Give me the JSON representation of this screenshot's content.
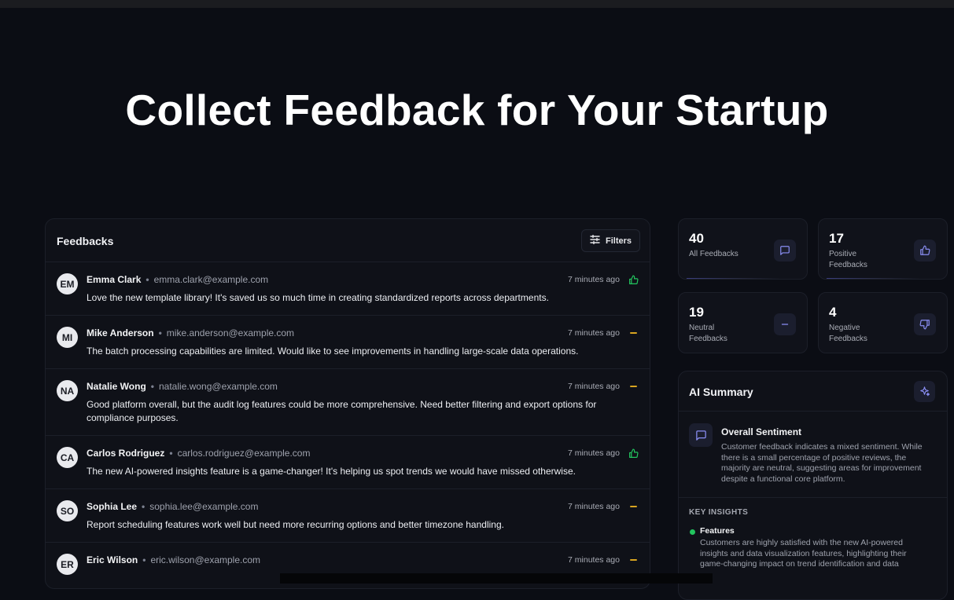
{
  "hero": {
    "title": "Collect Feedback for Your Startup"
  },
  "feedbacks": {
    "title": "Feedbacks",
    "filters_label": "Filters",
    "items": [
      {
        "initials": "EM",
        "name": "Emma Clark",
        "email": "emma.clark@example.com",
        "time": "7 minutes ago",
        "sentiment": "positive",
        "message": "Love the new template library! It's saved us so much time in creating standardized reports across departments."
      },
      {
        "initials": "MI",
        "name": "Mike Anderson",
        "email": "mike.anderson@example.com",
        "time": "7 minutes ago",
        "sentiment": "neutral",
        "message": "The batch processing capabilities are limited. Would like to see improvements in handling large-scale data operations."
      },
      {
        "initials": "NA",
        "name": "Natalie Wong",
        "email": "natalie.wong@example.com",
        "time": "7 minutes ago",
        "sentiment": "neutral",
        "message": "Good platform overall, but the audit log features could be more comprehensive. Need better filtering and export options for compliance purposes."
      },
      {
        "initials": "CA",
        "name": "Carlos Rodriguez",
        "email": "carlos.rodriguez@example.com",
        "time": "7 minutes ago",
        "sentiment": "positive",
        "message": "The new AI-powered insights feature is a game-changer! It's helping us spot trends we would have missed otherwise."
      },
      {
        "initials": "SO",
        "name": "Sophia Lee",
        "email": "sophia.lee@example.com",
        "time": "7 minutes ago",
        "sentiment": "neutral",
        "message": "Report scheduling features work well but need more recurring options and better timezone handling."
      },
      {
        "initials": "ER",
        "name": "Eric Wilson",
        "email": "eric.wilson@example.com",
        "time": "7 minutes ago",
        "sentiment": "neutral",
        "message": ""
      }
    ]
  },
  "stats": {
    "all": {
      "value": "40",
      "label": "All Feedbacks",
      "icon": "message-square-icon"
    },
    "positive": {
      "value": "17",
      "label": "Positive Feedbacks",
      "icon": "thumbs-up-icon"
    },
    "neutral": {
      "value": "19",
      "label": "Neutral Feedbacks",
      "icon": "minus-icon"
    },
    "negative": {
      "value": "4",
      "label": "Negative Feedbacks",
      "icon": "thumbs-down-icon"
    }
  },
  "ai_summary": {
    "title": "AI Summary",
    "sentiment_title": "Overall Sentiment",
    "sentiment_text": "Customer feedback indicates a mixed sentiment. While there is a small percentage of positive reviews, the majority are neutral, suggesting areas for improvement despite a functional core platform.",
    "key_insights_label": "KEY INSIGHTS",
    "insight_title": "Features",
    "insight_text": "Customers are highly satisfied with the new AI-powered insights and data visualization features, highlighting their game-changing impact on trend identification and data"
  },
  "colors": {
    "positive": "#22c55e",
    "neutral": "#d9a520",
    "accent": "#8b8ff5"
  }
}
